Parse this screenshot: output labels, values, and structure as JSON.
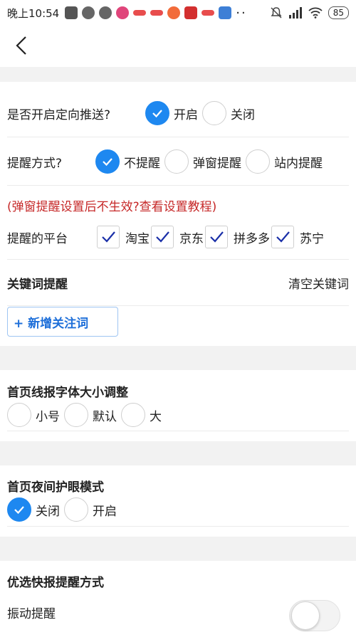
{
  "status_bar": {
    "time": "晚上10:54",
    "battery": "85"
  },
  "push": {
    "label": "是否开启定向推送?",
    "options": [
      {
        "label": "开启",
        "selected": true
      },
      {
        "label": "关闭",
        "selected": false
      }
    ]
  },
  "remind": {
    "label": "提醒方式?",
    "options": [
      {
        "label": "不提醒",
        "selected": true
      },
      {
        "label": "弹窗提醒",
        "selected": false
      },
      {
        "label": "站内提醒",
        "selected": false
      }
    ]
  },
  "warning": "(弹窗提醒设置后不生效?查看设置教程)",
  "platform": {
    "label": "提醒的平台",
    "options": [
      {
        "label": "淘宝",
        "checked": true
      },
      {
        "label": "京东",
        "checked": true
      },
      {
        "label": "拼多多",
        "checked": true
      },
      {
        "label": "苏宁",
        "checked": true
      }
    ]
  },
  "keywords": {
    "title": "关键词提醒",
    "clear_label": "清空关键词",
    "add_label": "+ 新增关注词"
  },
  "font_size": {
    "title": "首页线报字体大小调整",
    "options": [
      {
        "label": "小号",
        "selected": false
      },
      {
        "label": "默认",
        "selected": false
      },
      {
        "label": "大",
        "selected": false
      }
    ]
  },
  "night_mode": {
    "title": "首页夜间护眼模式",
    "options": [
      {
        "label": "关闭",
        "selected": true
      },
      {
        "label": "开启",
        "selected": false
      }
    ]
  },
  "quick_remind": {
    "title": "优选快报提醒方式",
    "vibrate_label": "振动提醒",
    "vibrate_on": false
  },
  "colors": {
    "accent": "#1e88f0",
    "warning": "#c62828",
    "check": "#1a2fa8"
  }
}
